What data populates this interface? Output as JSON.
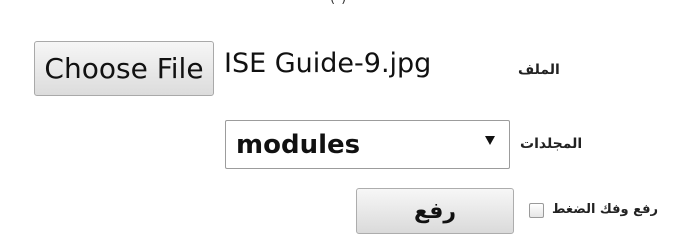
{
  "header": {
    "cut_text": "(       )"
  },
  "file_row": {
    "label": "الملف",
    "choose_button_label": "Choose File",
    "selected_file_name": "ISE Guide-9.jpg"
  },
  "folder_row": {
    "label": "المجلدات",
    "selected_value": "modules",
    "arrow_icon": "triangle-down"
  },
  "upload_row": {
    "compress_label": "رفع وفك الضغط",
    "compress_checked": false,
    "upload_button_label": "رفع"
  }
}
